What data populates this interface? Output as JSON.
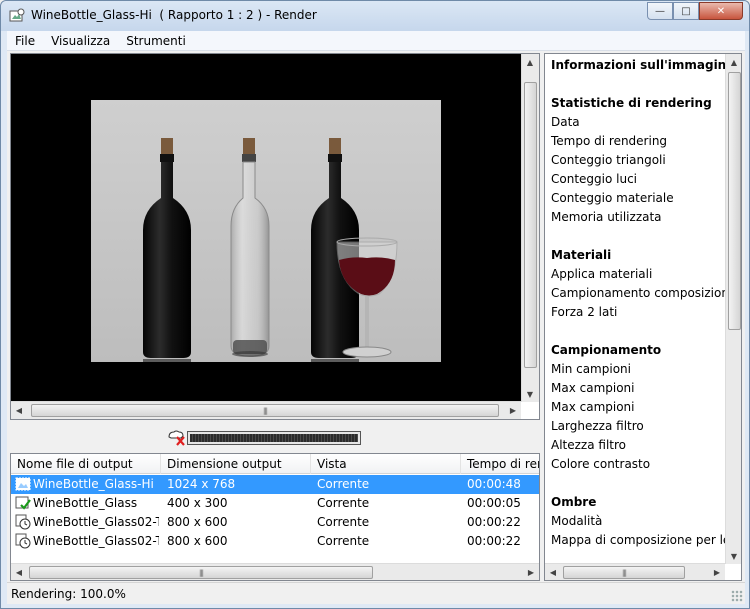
{
  "window": {
    "title": "WineBottle_Glass-Hi  ( Rapporto 1 : 2 ) - Render",
    "minimize": "—",
    "maximize": "□",
    "close": "✕"
  },
  "menu": [
    "File",
    "Visualizza",
    "Strumenti"
  ],
  "scrollbar_grip": "|||",
  "progress": {
    "fraction": 1.0
  },
  "output_list": {
    "columns": [
      "Nome file di output",
      "Dimensione output",
      "Vista",
      "Tempo di ren"
    ],
    "rows": [
      {
        "name": "WineBottle_Glass-Hi",
        "size": "1024 x 768",
        "view": "Corrente",
        "time": "00:00:48",
        "icon": "image-rendering-icon",
        "selected": true
      },
      {
        "name": "WineBottle_Glass",
        "size": "400 x 300",
        "view": "Corrente",
        "time": "00:00:05",
        "icon": "image-done-icon",
        "selected": false
      },
      {
        "name": "WineBottle_Glass02-T...",
        "size": "800 x 600",
        "view": "Corrente",
        "time": "00:00:22",
        "icon": "clock-icon",
        "selected": false
      },
      {
        "name": "WineBottle_Glass02-T...",
        "size": "800 x 600",
        "view": "Corrente",
        "time": "00:00:22",
        "icon": "clock-icon",
        "selected": false
      }
    ]
  },
  "info_panel": {
    "title": "Informazioni sull'immagine",
    "sections": [
      {
        "heading": "Statistiche di rendering",
        "items": [
          "Data",
          "Tempo di rendering",
          "Conteggio triangoli",
          "Conteggio luci",
          "Conteggio materiale",
          "Memoria utilizzata"
        ]
      },
      {
        "heading": "Materiali",
        "items": [
          "Applica materiali",
          "Campionamento composizione",
          "Forza 2 lati"
        ]
      },
      {
        "heading": "Campionamento",
        "items": [
          "Min campioni",
          "Max campioni",
          "Max campioni",
          "Larghezza filtro",
          "Altezza filtro",
          "Colore contrasto"
        ]
      },
      {
        "heading": "Ombre",
        "items": [
          "Modalità",
          "Mappa di composizione per le or"
        ]
      }
    ]
  },
  "status": {
    "text": "Rendering: 100.0%"
  },
  "colors": {
    "selection": "#3399ff",
    "accent_title": "#c6d7ec",
    "wine": "#5a0d16"
  }
}
